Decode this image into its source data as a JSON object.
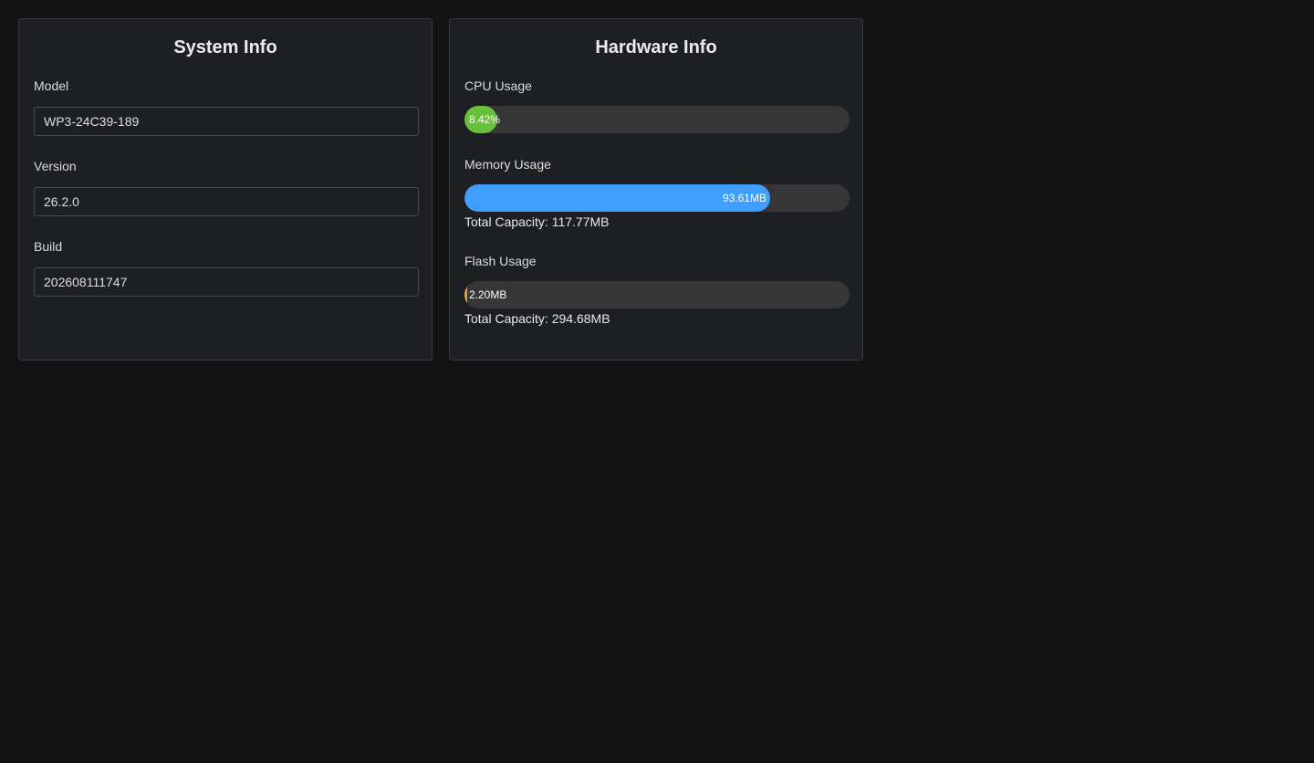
{
  "system": {
    "title": "System Info",
    "fields": [
      {
        "label": "Model",
        "value": "WP3-24C39-189"
      },
      {
        "label": "Version",
        "value": "26.2.0"
      },
      {
        "label": "Build",
        "value": "202608111747"
      }
    ]
  },
  "hardware": {
    "title": "Hardware Info",
    "cpu": {
      "label": "CPU Usage",
      "value_text": "8.42%",
      "fraction": 0.0842,
      "color": "#67c23a"
    },
    "memory": {
      "label": "Memory Usage",
      "value_text": "93.61MB",
      "fraction": 0.795,
      "color": "#409eff",
      "capacity_text": "Total Capacity: 117.77MB"
    },
    "flash": {
      "label": "Flash Usage",
      "value_text": "2.20MB",
      "fraction": 0.0075,
      "color": "#e6a23c",
      "capacity_text": "Total Capacity: 294.68MB"
    }
  }
}
